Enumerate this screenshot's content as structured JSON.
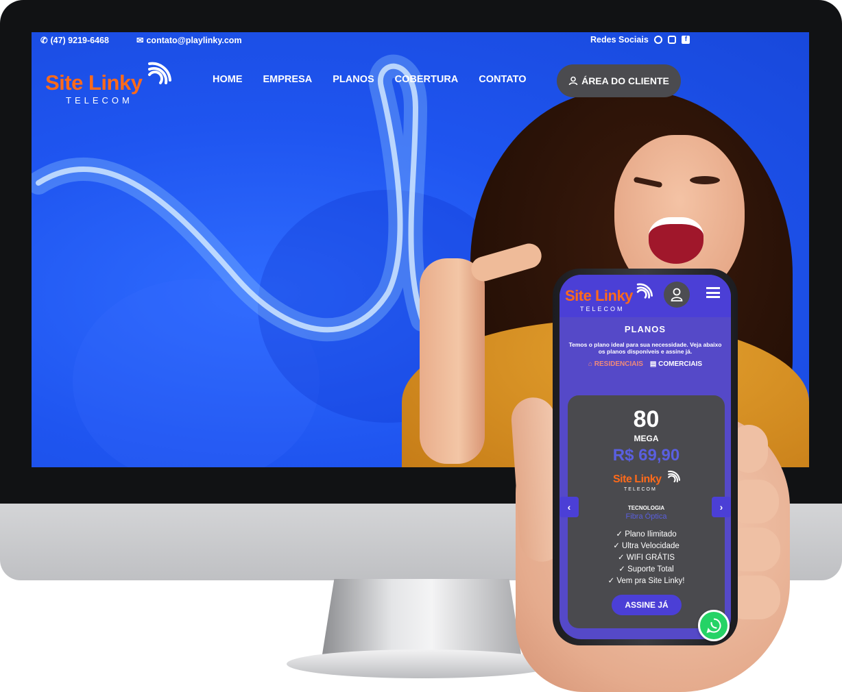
{
  "desktop": {
    "topbar": {
      "phone": "(47) 9219-6468",
      "email": "contato@playlinky.com",
      "social_label": "Redes Sociais",
      "social_icons": [
        "whatsapp-icon",
        "instagram-icon",
        "facebook-icon"
      ]
    },
    "logo": {
      "name": "Site Linky",
      "tagline": "TELECOM"
    },
    "nav": {
      "items": [
        "HOME",
        "EMPRESA",
        "PLANOS",
        "COBERTURA",
        "CONTATO"
      ],
      "client_button": "ÁREA DO CLIENTE"
    }
  },
  "mobile": {
    "logo": {
      "name": "Site Linky",
      "tagline": "TELECOM"
    },
    "section_title": "PLANOS",
    "description": "Temos o plano ideal para sua necessidade. Veja abaixo os planos disponíveis e assine já.",
    "tabs": {
      "residential": "RESIDENCIAIS",
      "commercial": "COMERCIAIS"
    },
    "plan": {
      "speed": "80",
      "unit": "MEGA",
      "price": "R$ 69,90",
      "logo_name": "Site Linky",
      "logo_tagline": "TELECOM",
      "tech_label": "TECNOLOGIA",
      "tech_value": "Fibra Óptica",
      "features": [
        "✓ Plano Ilimitado",
        "✓ Ultra Velocidade",
        "✓ WIFI GRÁTIS",
        "✓ Suporte Total",
        "✓ Vem pra Site Linky!"
      ],
      "cta": "ASSINE JÁ"
    },
    "arrows": {
      "prev": "‹",
      "next": "›"
    }
  },
  "colors": {
    "brand_orange": "#ff6a1a",
    "brand_blue": "#1f55f0",
    "mobile_purple": "#4b3fd6",
    "whatsapp_green": "#25d366"
  }
}
